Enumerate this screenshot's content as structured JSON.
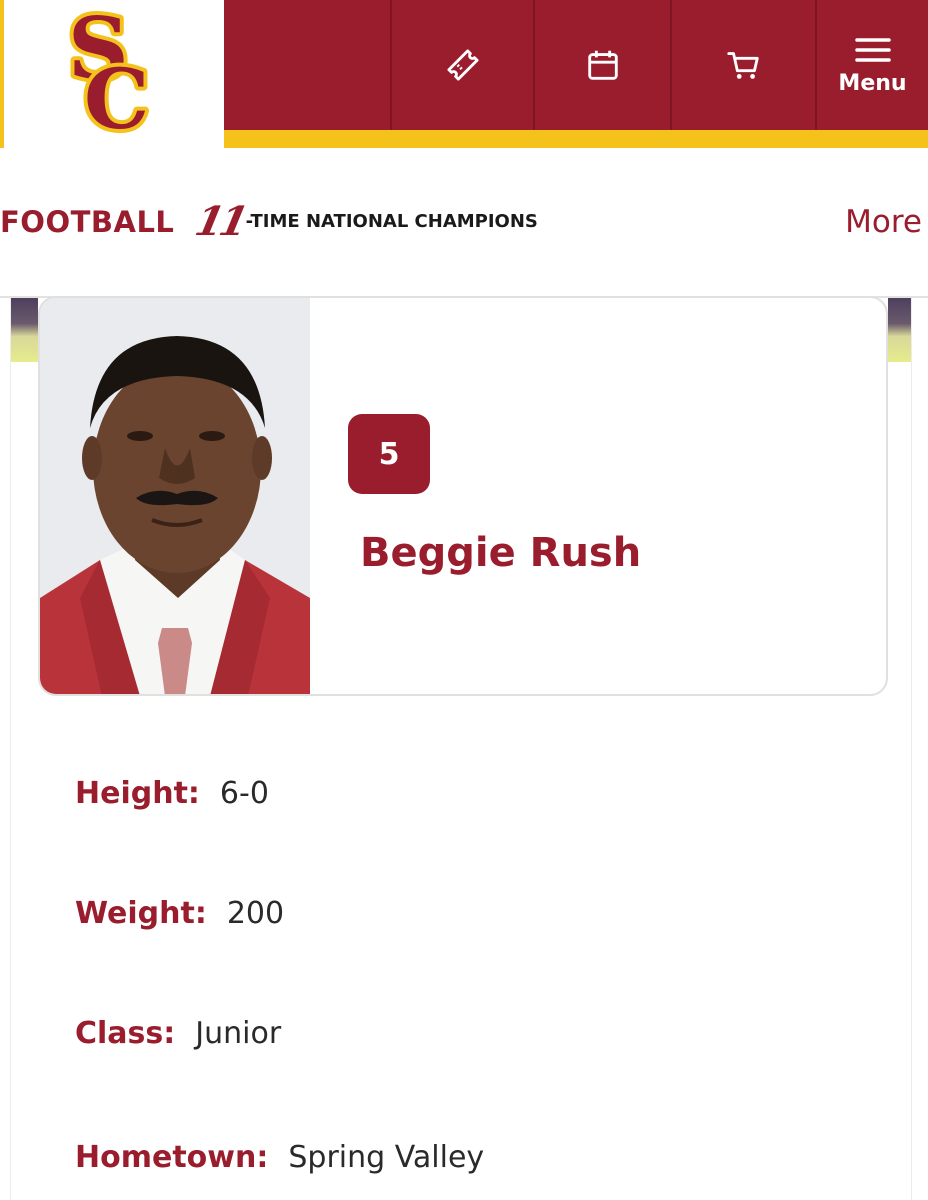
{
  "header": {
    "nav": {
      "tickets_icon": "ticket-icon",
      "schedule_icon": "calendar-icon",
      "shop_icon": "cart-icon",
      "menu_icon": "hamburger-icon",
      "menu_label": "Menu"
    },
    "logo": "SC"
  },
  "subheader": {
    "sport": "FOOTBALL",
    "championships_number": "11",
    "championships_text": "-TIME NATIONAL CHAMPIONS",
    "more_label": "More"
  },
  "player": {
    "number": "5",
    "name": "Beggie Rush"
  },
  "bio": [
    {
      "label": "Height:",
      "value": "6-0"
    },
    {
      "label": "Weight:",
      "value": "200"
    },
    {
      "label": "Class:",
      "value": "Junior"
    },
    {
      "label": "Hometown:",
      "value": "Spring Valley"
    }
  ],
  "colors": {
    "cardinal": "#9a1d2e",
    "gold": "#f5c21b"
  }
}
